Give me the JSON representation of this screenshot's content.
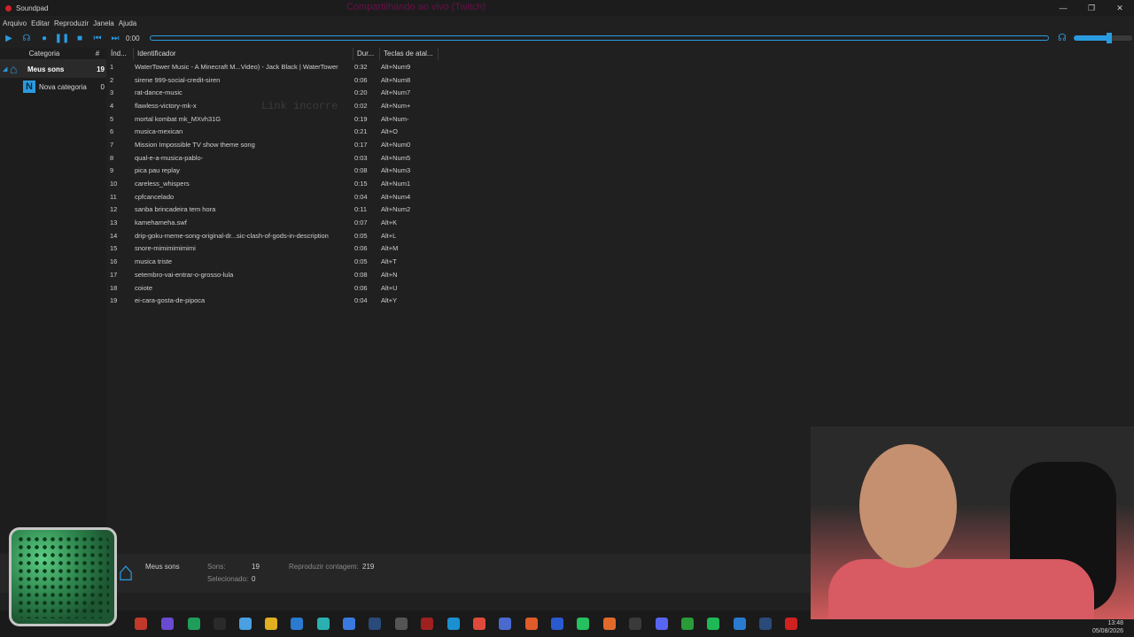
{
  "window": {
    "title": "Soundpad",
    "overlay_title": "Compartilhando ao vivo (Twitch)"
  },
  "menu": [
    "Arquivo",
    "Editar",
    "Reproduzir",
    "Janela",
    "Ajuda"
  ],
  "player": {
    "time": "0:00",
    "volume": 0.6
  },
  "sidebar": {
    "header_category": "Categoria",
    "header_count": "#",
    "categories": [
      {
        "label": "Meus sons",
        "count": "19"
      },
      {
        "label": "Nova categoria",
        "count": "0"
      }
    ]
  },
  "table": {
    "headers": {
      "index": "Índ...",
      "id": "Identificador",
      "dur": "Dur...",
      "keys": "Teclas de atal..."
    },
    "rows": [
      {
        "i": "1",
        "name": "WaterTower Music - A Minecraft M...Video) - Jack Black | WaterTower",
        "dur": "0:32",
        "key": "Alt+Num9"
      },
      {
        "i": "2",
        "name": "sirene 999-social-credit-siren",
        "dur": "0:06",
        "key": "Alt+Num8"
      },
      {
        "i": "3",
        "name": "rat-dance-music",
        "dur": "0:20",
        "key": "Alt+Num7"
      },
      {
        "i": "4",
        "name": "flawless-victory-mk-x",
        "dur": "0:02",
        "key": "Alt+Num+"
      },
      {
        "i": "5",
        "name": "mortal kombat mk_MXvh31G",
        "dur": "0:19",
        "key": "Alt+Num-"
      },
      {
        "i": "6",
        "name": "musica-mexican",
        "dur": "0:21",
        "key": "Alt+O"
      },
      {
        "i": "7",
        "name": "Mission Impossible TV show theme song",
        "dur": "0:17",
        "key": "Alt+Num0"
      },
      {
        "i": "8",
        "name": "qual-e-a-musica-pablo-",
        "dur": "0:03",
        "key": "Alt+Num5"
      },
      {
        "i": "9",
        "name": "pica pau replay",
        "dur": "0:08",
        "key": "Alt+Num3"
      },
      {
        "i": "10",
        "name": "careless_whispers",
        "dur": "0:15",
        "key": "Alt+Num1"
      },
      {
        "i": "11",
        "name": "cpfcancelado",
        "dur": "0:04",
        "key": "Alt+Num4"
      },
      {
        "i": "12",
        "name": "sanba brincadeira tem hora",
        "dur": "0:11",
        "key": "Alt+Num2"
      },
      {
        "i": "13",
        "name": "kamehameha.swf",
        "dur": "0:07",
        "key": "Alt+K"
      },
      {
        "i": "14",
        "name": "drip-goku-meme-song-original-dr...sic-clash-of-gods-in-description",
        "dur": "0:05",
        "key": "Alt+L"
      },
      {
        "i": "15",
        "name": "snore-mimimimimimi",
        "dur": "0:06",
        "key": "Alt+M"
      },
      {
        "i": "16",
        "name": "musica triste",
        "dur": "0:05",
        "key": "Alt+T"
      },
      {
        "i": "17",
        "name": "setembro-vai-entrar-o-grosso-lula",
        "dur": "0:08",
        "key": "Alt+N"
      },
      {
        "i": "18",
        "name": "coiote",
        "dur": "0:06",
        "key": "Alt+U"
      },
      {
        "i": "19",
        "name": "ei-cara-gosta-de-pipoca",
        "dur": "0:04",
        "key": "Alt+Y"
      }
    ]
  },
  "ghost_text": "Link incorre",
  "status": {
    "category": "Meus sons",
    "sounds_label": "Sons:",
    "sounds_value": "19",
    "selected_label": "Selecionado:",
    "selected_value": "0",
    "play_count_label": "Reproduzir contagem:",
    "play_count_value": "219"
  },
  "clock": {
    "time": "13:48",
    "date": "05/08/2026"
  },
  "colors": {
    "accent": "#2a9be0",
    "background": "#202020"
  }
}
